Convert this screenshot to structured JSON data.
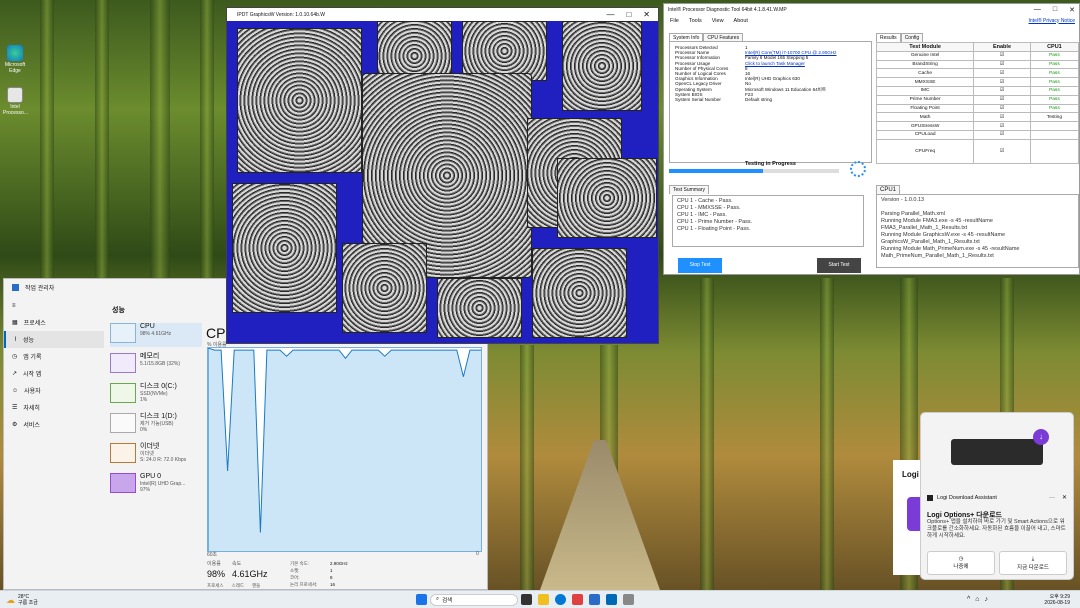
{
  "desktop": {
    "icons": [
      {
        "label": "Microsoft Edge"
      },
      {
        "label": "Intel Processo..."
      }
    ]
  },
  "graphics_window": {
    "title": "IPDT GraphicsW Version: 1.0.10.64b.W"
  },
  "pdt": {
    "title": "Intel® Processor Diagnostic Tool 64bit 4.1.8.41.W.MP",
    "privacy": "Intel® Privacy Notice",
    "menu": [
      "File",
      "Tools",
      "View",
      "About"
    ],
    "tabs": {
      "info": "System Info",
      "features": "CPU Features",
      "results": "Results",
      "config": "Config",
      "summary": "Test Summary",
      "cpu1": "CPU1"
    },
    "info_rows": [
      {
        "k": "Processors Detected",
        "v": "1"
      },
      {
        "k": "Processor Name",
        "v": "Intel(R) Core(TM) i7-10700 CPU @ 2.90GHz"
      },
      {
        "k": "Processor Information",
        "v": "Family 6 Model 165 Stepping 5"
      },
      {
        "k": "Processor Usage",
        "v": "Click to launch Task Manager"
      },
      {
        "k": "Number of Physical Cores",
        "v": "8"
      },
      {
        "k": "Number of Logical Cores",
        "v": "16"
      },
      {
        "k": "Graphics Information",
        "v": "Intel(R) UHD Graphics 630"
      },
      {
        "k": "OpenCL Legacy Driver",
        "v": "No"
      },
      {
        "k": "Operating System",
        "v": "Microsoft Windows 11 Education 64비트"
      },
      {
        "k": "System BIOS",
        "v": "F23"
      },
      {
        "k": "System Serial Number",
        "v": "Default string"
      }
    ],
    "progress_label": "Testing in Progress",
    "progress": 0.55,
    "table_headers": [
      "Test Module",
      "Enable",
      "CPU1"
    ],
    "modules": [
      {
        "name": "Genuine Intel",
        "status": "Pass"
      },
      {
        "name": "BrandString",
        "status": "Pass"
      },
      {
        "name": "Cache",
        "status": "Pass"
      },
      {
        "name": "MMXSSE",
        "status": "Pass"
      },
      {
        "name": "IMC",
        "status": "Pass"
      },
      {
        "name": "Prime Number",
        "status": "Pass"
      },
      {
        "name": "Floating Point",
        "status": "Pass"
      },
      {
        "name": "Math",
        "status": "Testing"
      },
      {
        "name": "GPUStressW",
        "status": ""
      },
      {
        "name": "CPULoad",
        "status": ""
      },
      {
        "name": "CPUFreq",
        "status": ""
      }
    ],
    "summary_log": [
      "CPU 1 - Cache - Pass.",
      "CPU 1 - MMXSSE - Pass.",
      "CPU 1 - IMC - Pass.",
      "CPU 1 - Prime Number - Pass.",
      "CPU 1 - Floating Point - Pass."
    ],
    "cpu1_log": [
      "Version - 1.0.0.13",
      "",
      "Parsing Parallel_Math.xml",
      "Running Module FMA3.exe -s 45 -resultName FMA3_Parallel_Math_1_Results.txt",
      "Running Module GraphicsW.exe -s 45 -resultName GraphicsW_Parallel_Math_1_Results.txt",
      "Running Module Math_PrimeNum.exe -s 45 -resultName Math_PrimeNum_Parallel_Math_1_Results.txt"
    ],
    "stop_button": "Stop Test",
    "start_button": "Start Test"
  },
  "taskmgr": {
    "title": "작업 관리자",
    "nav": [
      "프로세스",
      "성능",
      "앱 기록",
      "시작 앱",
      "사용자",
      "자세히",
      "서비스"
    ],
    "header": "성능",
    "devices": [
      {
        "name": "CPU",
        "sub1": "98% 4.61GHz",
        "sub2": ""
      },
      {
        "name": "메모리",
        "sub1": "5.1/15.8GB (32%)",
        "sub2": ""
      },
      {
        "name": "디스크 0(C:)",
        "sub1": "SSD(NVMe)",
        "sub2": "1%"
      },
      {
        "name": "디스크 1(D:)",
        "sub1": "제거 가능(USB)",
        "sub2": "0%"
      },
      {
        "name": "이더넷",
        "sub1": "이더넷",
        "sub2": "S: 24.0 R: 72.0 Kbps"
      },
      {
        "name": "GPU 0",
        "sub1": "Intel(R) UHD Grap...",
        "sub2": "97%"
      }
    ],
    "cpu_title": "CPU",
    "graph_label": "% 이용률",
    "time_left": "60초",
    "time_right": "0",
    "stats": {
      "usage_label": "이용률",
      "usage": "98%",
      "speed_label": "속도",
      "speed": "4.61GHz",
      "base_label": "기본 속도:",
      "base": "2.90GHz",
      "socket_label": "소켓:",
      "socket": "1",
      "core_label": "코어:",
      "core": "8",
      "lp_label": "논리 프로세서:",
      "lp": "16",
      "proc_label": "프로세스",
      "thread_label": "스레드",
      "handle_label": "핸들"
    },
    "usage_curve": [
      100,
      99,
      99,
      40,
      99,
      99,
      99,
      99,
      10,
      99,
      99,
      99,
      96,
      99,
      99,
      99,
      99,
      99,
      99,
      99,
      99,
      95,
      99,
      99,
      99,
      99,
      99,
      96,
      99,
      99,
      99,
      99,
      99,
      99,
      99,
      99,
      99,
      99,
      99,
      86,
      99,
      99,
      99
    ]
  },
  "notification": {
    "app": "Logi Download Assistant",
    "headline": "Logi Options+ 다운로드",
    "body": "Options+ 앱을 설치하여 바로 가기 및 Smart Actions으로 워크플로를 간소화하세요. 자동화된 흐름을 이끌어 내고, 스마트하게 시작하세요.",
    "later": "나중에",
    "download": "지금 다운로드",
    "partial": "Logi"
  },
  "taskbar": {
    "weather_temp": "28°C",
    "weather_desc": "구름 조금",
    "search": "검색",
    "time": "오후 9:29",
    "date": "2026-08-19"
  }
}
